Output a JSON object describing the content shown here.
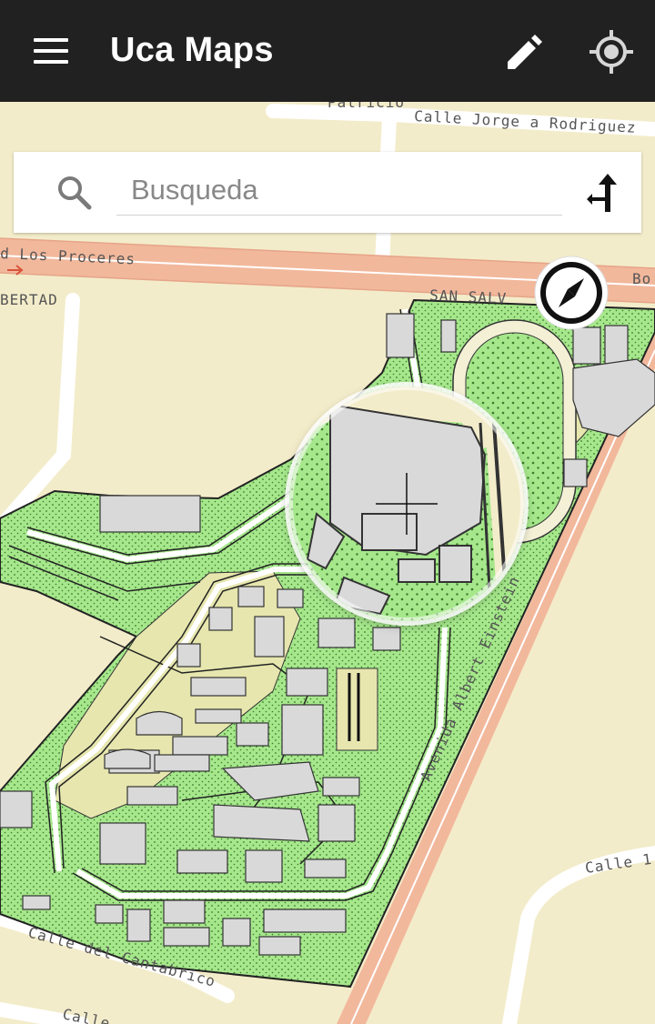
{
  "app": {
    "title": "Uca Maps"
  },
  "search": {
    "placeholder": "Busqueda",
    "value": ""
  },
  "map": {
    "streets": {
      "jorge_rodriguez": "Calle Jorge a Rodriguez",
      "patricio": "Patricio",
      "los_proceres": "d Los Proceres",
      "bo": "Bo",
      "san_salvador": "SAN SALV",
      "libertad": "BERTAD",
      "albert_einstein": "Avenida Albert Einstein",
      "cantabrico": "Calle del Cantabrico",
      "calle_1": "Calle 1",
      "calle_bottom": "Calle"
    },
    "colors": {
      "land": "#f3ecca",
      "campus_green": "#a6e78c",
      "building": "#d9d9d9",
      "road_major": "#f2b89c",
      "road_minor": "#ffffff",
      "appbar": "#212121"
    }
  },
  "icons": {
    "menu": "menu-icon",
    "edit": "pencil-icon",
    "locate": "my-location-icon",
    "search": "search-icon",
    "directions": "directions-icon",
    "compass": "compass-icon",
    "crosshair": "crosshair-icon"
  }
}
